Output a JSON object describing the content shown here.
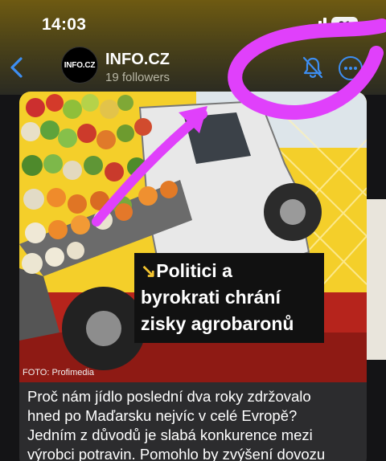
{
  "status_bar": {
    "time": "14:03",
    "battery": "91"
  },
  "channel": {
    "avatar_text": "INFO.CZ",
    "name": "INFO.CZ",
    "followers": "19 followers"
  },
  "post": {
    "headline_lines": [
      "Politici a",
      "byrokrati chrání",
      "zisky agrobaronů"
    ],
    "headline_arrow": "↘",
    "photo_credit": "FOTO: Profimedia",
    "body_lines": [
      "Proč nám jídlo poslední dva roky zdržovalo",
      "hned po Maďarsku nejvíc v celé Evropě?",
      "Jedním z důvodů je slabá konkurence mezi",
      "výrobci potravin. Pomohlo by zvýšení dovozu"
    ]
  },
  "icons": [
    "back-chevron-icon",
    "bell-muted-icon",
    "more-options-icon",
    "signal-icon"
  ],
  "colors": {
    "accent": "#3d8ef2",
    "annotation": "#e040fb",
    "headline_bg": "#111111",
    "photo_bg": "#f4cf2a"
  }
}
